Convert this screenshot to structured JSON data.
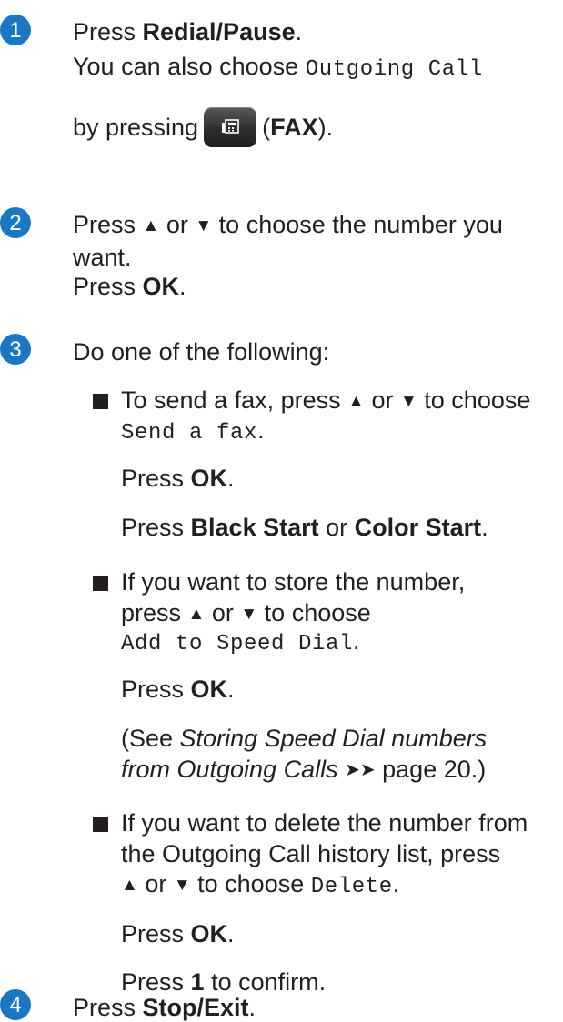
{
  "colors": {
    "accent": "#1a78c2",
    "text": "#231f20"
  },
  "icons": {
    "fax_key": "fax-icon",
    "bullet": "square-bullet"
  },
  "steps": [
    {
      "number": "1",
      "l1_pre": "Press ",
      "l1_key": "Redial/Pause",
      "l1_post": ".",
      "l2_pre": "You can also choose ",
      "l2_mono": "Outgoing Call",
      "l3_pre": "by pressing",
      "l3_open": "(",
      "l3_key": "FAX",
      "l3_close": ")."
    },
    {
      "number": "2",
      "l1_pre": "Press ",
      "l1_up": "▲",
      "l1_or": " or ",
      "l1_down": "▼",
      "l1_post": " to choose the number you",
      "l2": "want.",
      "l3_pre": "Press ",
      "l3_key": "OK",
      "l3_post": "."
    },
    {
      "number": "3",
      "l1": "Do one of the following:",
      "bullets": [
        {
          "a_pre": "To send a fax, press ",
          "a_up": "▲",
          "a_or": " or ",
          "a_down": "▼",
          "a_post": " to choose",
          "b_mono": "Send a fax",
          "b_post": ".",
          "c_pre": "Press ",
          "c_key": "OK",
          "c_post": ".",
          "d_pre": "Press ",
          "d_key1": "Black Start",
          "d_or": " or ",
          "d_key2": "Color Start",
          "d_post": "."
        },
        {
          "a": "If you want to store the number,",
          "b_pre": "press ",
          "b_up": "▲",
          "b_or": " or ",
          "b_down": "▼",
          "b_post": " to choose",
          "c_mono": "Add to Speed Dial",
          "c_post": ".",
          "d_pre": "Press ",
          "d_key": "OK",
          "d_post": ".",
          "e_open": "(See ",
          "e_ital": "Storing Speed Dial numbers",
          "f_ital": "from Outgoing Calls",
          "f_arrows": "➤➤",
          "f_post": " page 20.)"
        },
        {
          "a": "If you want to delete the number from",
          "b": "the Outgoing Call history list, press",
          "c_up": "▲",
          "c_or": " or ",
          "c_down": "▼",
          "c_mid": " to choose ",
          "c_mono": "Delete",
          "c_post": ".",
          "d_pre": "Press ",
          "d_key": "OK",
          "d_post": ".",
          "e_pre": "Press ",
          "e_key": "1",
          "e_post": " to confirm."
        }
      ]
    },
    {
      "number": "4",
      "l1_pre": "Press ",
      "l1_key": "Stop/Exit",
      "l1_post": "."
    }
  ]
}
